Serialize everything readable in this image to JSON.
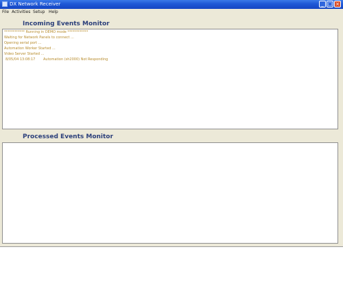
{
  "window": {
    "title": "DX Network Receiver",
    "minimize_glyph": "_",
    "maximize_glyph": "□",
    "close_glyph": "×"
  },
  "menu": {
    "items": [
      {
        "label": "File"
      },
      {
        "label": "Activities"
      },
      {
        "label": "Setup"
      },
      {
        "label": "Help"
      }
    ]
  },
  "incoming": {
    "title": "Incoming Events Monitor",
    "lines": [
      {
        "text": "************ Running in DEMO mode ************"
      },
      {
        "text": "Waiting for Network Panels to connect ..."
      },
      {
        "text": "Opening serial port ..."
      },
      {
        "text": "Automation Worker Started ..."
      },
      {
        "text": "Video Server Started ..."
      }
    ],
    "event": {
      "time": "8/05/04  13:08:17",
      "message": "Automation (sh2000) Not Responding"
    }
  },
  "processed": {
    "title": "Processed Events Monitor"
  },
  "colors": {
    "log_text": "#b68a2a",
    "section_title": "#2b3f7a",
    "titlebar": "#1e57d6"
  }
}
